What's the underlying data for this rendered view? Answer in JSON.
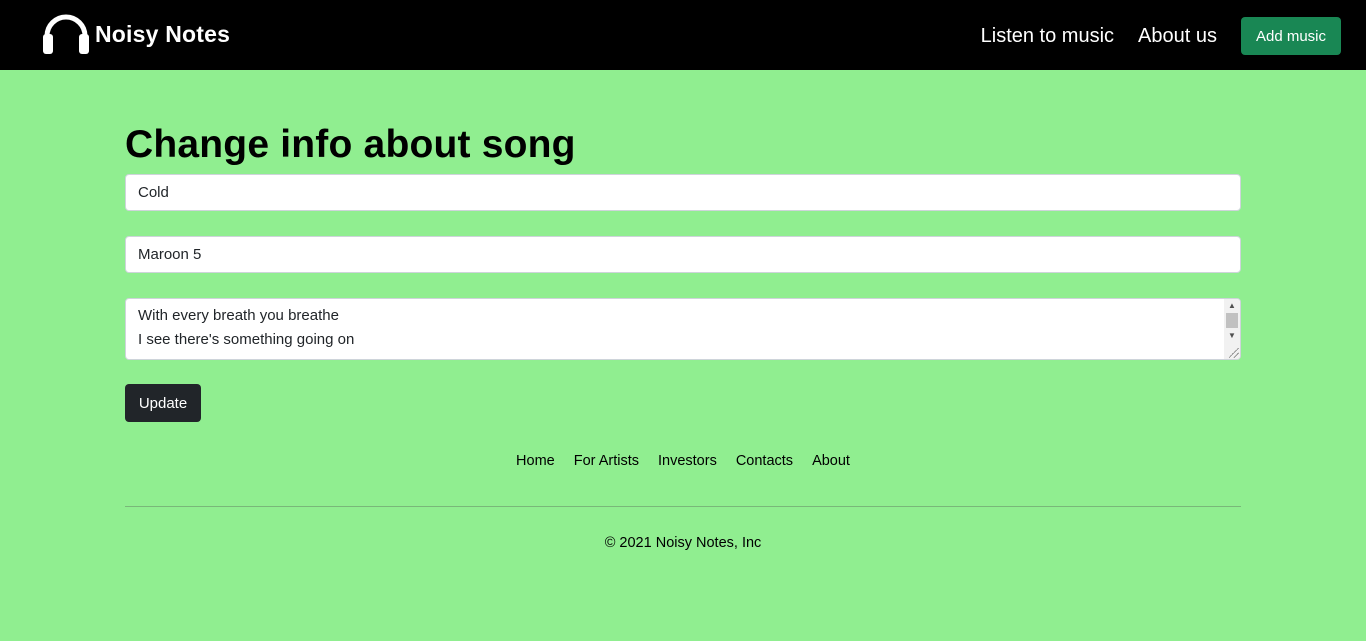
{
  "header": {
    "brand": "Noisy Notes",
    "brand_icon": "headphones-icon",
    "nav": [
      {
        "label": "Listen to music"
      },
      {
        "label": "About us"
      }
    ],
    "add_button": "Add music",
    "add_button_color": "#198754"
  },
  "main": {
    "title": "Change info about song",
    "song_title_value": "Cold",
    "artist_value": "Maroon 5",
    "lyrics_lines": [
      "With every breath you breathe",
      "I see there's something going on"
    ],
    "update_button": "Update"
  },
  "footer": {
    "links": [
      "Home",
      "For Artists",
      "Investors",
      "Contacts",
      "About"
    ],
    "copyright": "© 2021 Noisy Notes, Inc"
  },
  "colors": {
    "page_bg": "#90ee90",
    "navbar_bg": "#000000",
    "dark_button": "#212529"
  }
}
